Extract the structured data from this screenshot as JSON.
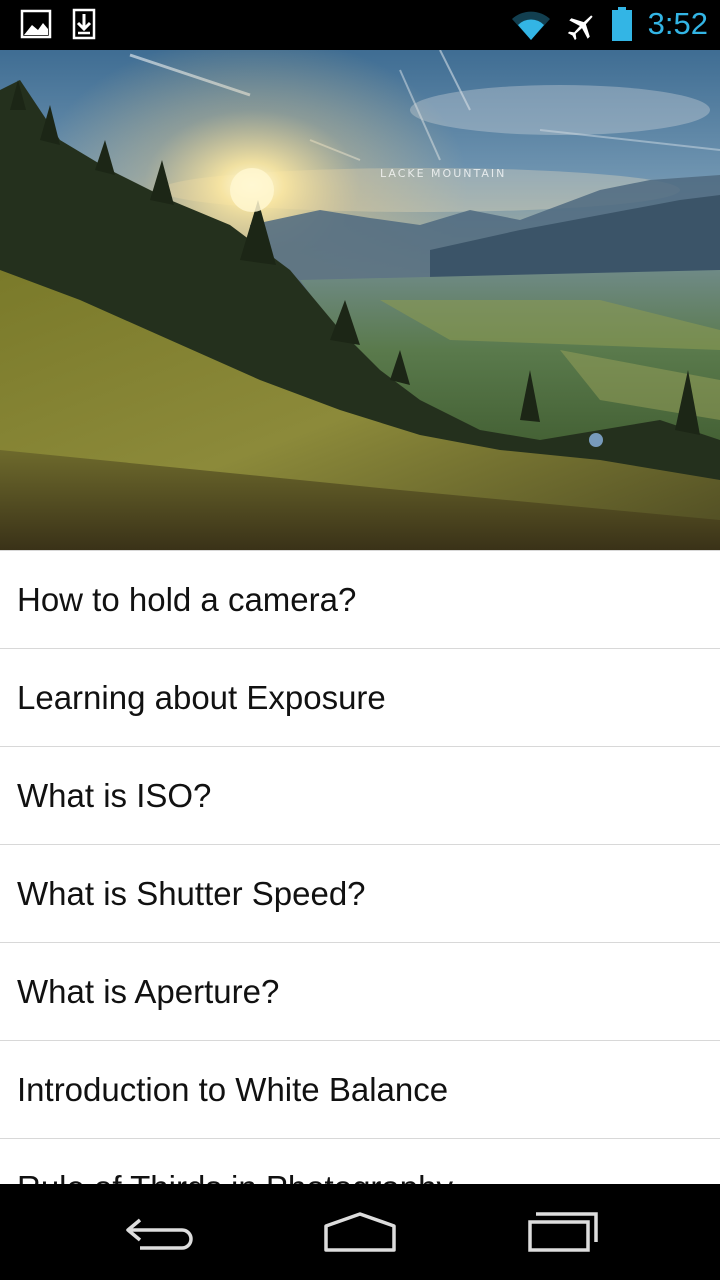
{
  "status_bar": {
    "time": "3:52",
    "accent_color": "#33b5e5",
    "left_icons": [
      "image-notification-icon",
      "download-notification-icon"
    ],
    "right_icons": [
      "wifi-icon",
      "airplane-mode-icon",
      "battery-icon"
    ]
  },
  "hero": {
    "description_icon": "mountain-landscape-image",
    "watermark": "LACKE MOUNTAIN"
  },
  "lessons": [
    {
      "label": "How to hold a camera?"
    },
    {
      "label": "Learning about Exposure"
    },
    {
      "label": "What is ISO?"
    },
    {
      "label": "What is Shutter Speed?"
    },
    {
      "label": "What is Aperture?"
    },
    {
      "label": "Introduction to White Balance"
    },
    {
      "label": "Rule of Thirds in Photography"
    }
  ],
  "nav_bar": {
    "buttons": [
      "back-icon",
      "home-icon",
      "recent-apps-icon"
    ]
  }
}
